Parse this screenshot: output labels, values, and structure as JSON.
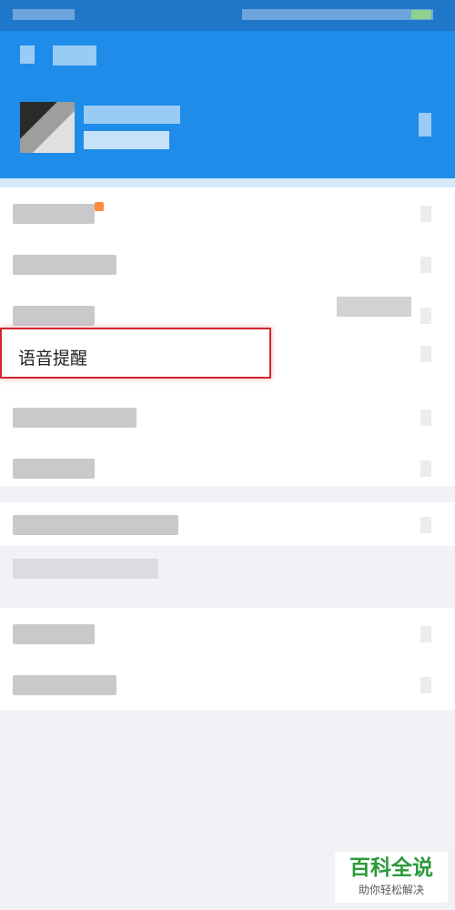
{
  "settings_list": {
    "highlighted_item_label": "语音提醒"
  },
  "watermark": {
    "main": "百科全说",
    "sub": "助你轻松解决"
  },
  "colors": {
    "header_blue": "#1e8ce8",
    "highlight_red": "#d2272f",
    "watermark_green": "#2c9a3a",
    "notification_orange": "#ff8c3a"
  },
  "icons": [
    "back-arrow-icon",
    "chevron-right-icon",
    "battery-icon"
  ]
}
